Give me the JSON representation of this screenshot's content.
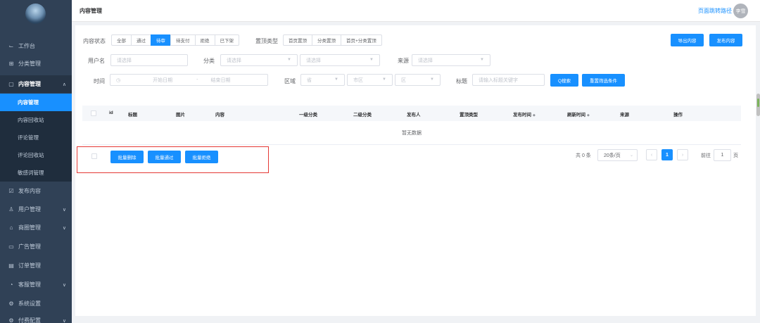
{
  "sidebar": {
    "items": [
      {
        "label": "工作台",
        "icon": "dashboard-icon"
      },
      {
        "label": "分类管理",
        "icon": "grid-icon"
      },
      {
        "label": "内容管理",
        "icon": "document-icon"
      },
      {
        "label": "发布内容",
        "icon": "edit-icon"
      },
      {
        "label": "用户管理",
        "icon": "user-icon"
      },
      {
        "label": "商圈管理",
        "icon": "shop-icon"
      },
      {
        "label": "广告管理",
        "icon": "ad-icon"
      },
      {
        "label": "订单管理",
        "icon": "order-icon"
      },
      {
        "label": "客服管理",
        "icon": "service-icon"
      },
      {
        "label": "系统设置",
        "icon": "settings-icon"
      },
      {
        "label": "付费配置",
        "icon": "payment-icon"
      }
    ],
    "sub_items": [
      {
        "label": "内容管理"
      },
      {
        "label": "内容回收站"
      },
      {
        "label": "评论管理"
      },
      {
        "label": "评论回收站"
      },
      {
        "label": "敏感词管理"
      }
    ]
  },
  "header": {
    "title": "内容管理",
    "path_link": "页面跳转路径",
    "avatar": "李雪"
  },
  "filters": {
    "status_label": "内容状态",
    "status_options": [
      "全部",
      "通过",
      "待审",
      "待支付",
      "拒绝",
      "已下架"
    ],
    "status_selected": "待审",
    "top_label": "置顶类型",
    "top_options": [
      "首页置顶",
      "分类置顶",
      "首页+分类置顶"
    ],
    "username_label": "用户名",
    "username_placeholder": "请选择",
    "category_label": "分类",
    "category_placeholder1": "请选择",
    "category_placeholder2": "请选择",
    "source_label": "来源",
    "source_placeholder": "请选择",
    "time_label": "时间",
    "start_date": "开始日期",
    "date_sep": "-",
    "end_date": "结束日期",
    "region_label": "区域",
    "province": "省",
    "city": "市区",
    "district": "区",
    "title_label": "标题",
    "title_placeholder": "请输入标题关键字",
    "search_button": "Q搜索",
    "reset_button": "重置筛选条件"
  },
  "actions": {
    "export_button": "导出内容",
    "publish_button": "发布内容"
  },
  "table": {
    "columns": [
      "id",
      "标题",
      "图片",
      "内容",
      "一级分类",
      "二级分类",
      "发布人",
      "置顶类型",
      "发布时间",
      "刷新时间",
      "来源",
      "操作"
    ],
    "empty_text": "暂无数据"
  },
  "bulk": {
    "delete": "批量删除",
    "approve": "批量通过",
    "reject": "批量拒绝"
  },
  "pagination": {
    "total": "共 0 条",
    "page_size": "20条/页",
    "current_page": "1",
    "goto_label": "前往",
    "goto_value": "1",
    "page_suffix": "页"
  },
  "colors": {
    "primary": "#1890ff",
    "sidebar_bg": "#304156",
    "highlight": "#e53935"
  }
}
